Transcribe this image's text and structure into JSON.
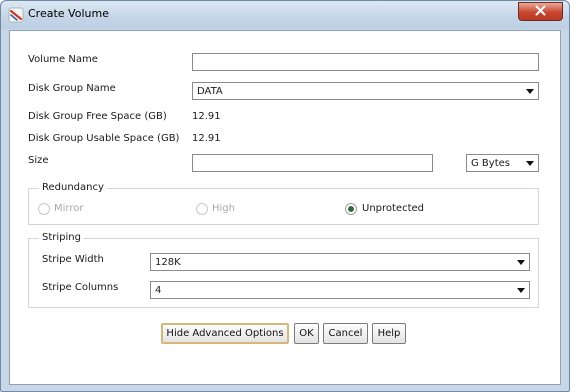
{
  "window": {
    "title": "Create Volume",
    "icon": "oracle-app-icon",
    "close_icon": "close-icon"
  },
  "form": {
    "volume_name": {
      "label": "Volume Name",
      "value": ""
    },
    "disk_group_name": {
      "label": "Disk Group Name",
      "value": "DATA"
    },
    "free_space": {
      "label": "Disk Group Free Space (GB)",
      "value": "12.91"
    },
    "usable_space": {
      "label": "Disk Group Usable Space (GB)",
      "value": "12.91"
    },
    "size": {
      "label": "Size",
      "value": "",
      "unit": "G Bytes"
    }
  },
  "redundancy": {
    "title": "Redundancy",
    "options": [
      {
        "label": "Mirror",
        "selected": false,
        "enabled": false
      },
      {
        "label": "High",
        "selected": false,
        "enabled": false
      },
      {
        "label": "Unprotected",
        "selected": true,
        "enabled": true
      }
    ]
  },
  "striping": {
    "title": "Striping",
    "stripe_width": {
      "label": "Stripe Width",
      "value": "128K"
    },
    "stripe_columns": {
      "label": "Stripe Columns",
      "value": "4"
    }
  },
  "buttons": {
    "hide_advanced": "Hide Advanced Options",
    "ok": "OK",
    "cancel": "Cancel",
    "help": "Help"
  },
  "colors": {
    "title_bar": "#c4d5e7",
    "close_button": "#c8452f",
    "radio_selected": "#2f6d3a",
    "default_button_border": "#d4b77a"
  }
}
